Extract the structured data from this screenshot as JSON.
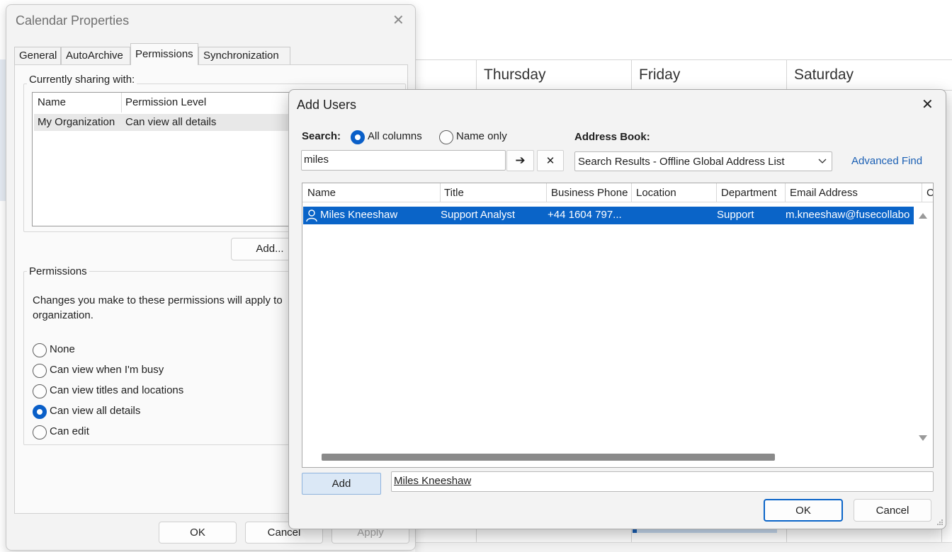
{
  "calendar": {
    "days": [
      "Thursday",
      "Friday",
      "Saturday"
    ]
  },
  "calendar_properties": {
    "title": "Calendar Properties",
    "tabs": [
      "General",
      "AutoArchive",
      "Permissions",
      "Synchronization"
    ],
    "active_tab": "Permissions",
    "sharing_group_label": "Currently sharing with:",
    "sharing_columns": [
      "Name",
      "Permission Level"
    ],
    "sharing_rows": [
      {
        "name": "My Organization",
        "level": "Can view all details"
      }
    ],
    "add_button": "Add...",
    "permissions_group_label": "Permissions",
    "permissions_description": "Changes you make to these permissions will apply to",
    "permissions_description_2": "organization.",
    "permission_options": [
      "None",
      "Can view when I'm busy",
      "Can view titles and locations",
      "Can view all details",
      "Can edit"
    ],
    "selected_permission": "Can view all details",
    "ok_button": "OK",
    "cancel_button": "Cancel",
    "apply_button": "Apply"
  },
  "add_users": {
    "title": "Add Users",
    "search_label": "Search:",
    "search_options": [
      "All columns",
      "Name only"
    ],
    "selected_search_option": "All columns",
    "search_value": "miles",
    "go_glyph": "➔",
    "clear_glyph": "✕",
    "address_book_label": "Address Book:",
    "address_book_value": "Search Results - Offline Global Address List",
    "advanced_find": "Advanced Find",
    "columns": [
      "Name",
      "Title",
      "Business Phone",
      "Location",
      "Department",
      "Email Address",
      "C"
    ],
    "results": [
      {
        "name": "Miles Kneeshaw",
        "title": "Support Analyst",
        "phone": "+44 1604 797...",
        "location": "",
        "department": "Support",
        "email": "m.kneeshaw@fusecollabo"
      }
    ],
    "add_button": "Add",
    "selected_users": "Miles Kneeshaw",
    "ok_button": "OK",
    "cancel_button": "Cancel"
  }
}
